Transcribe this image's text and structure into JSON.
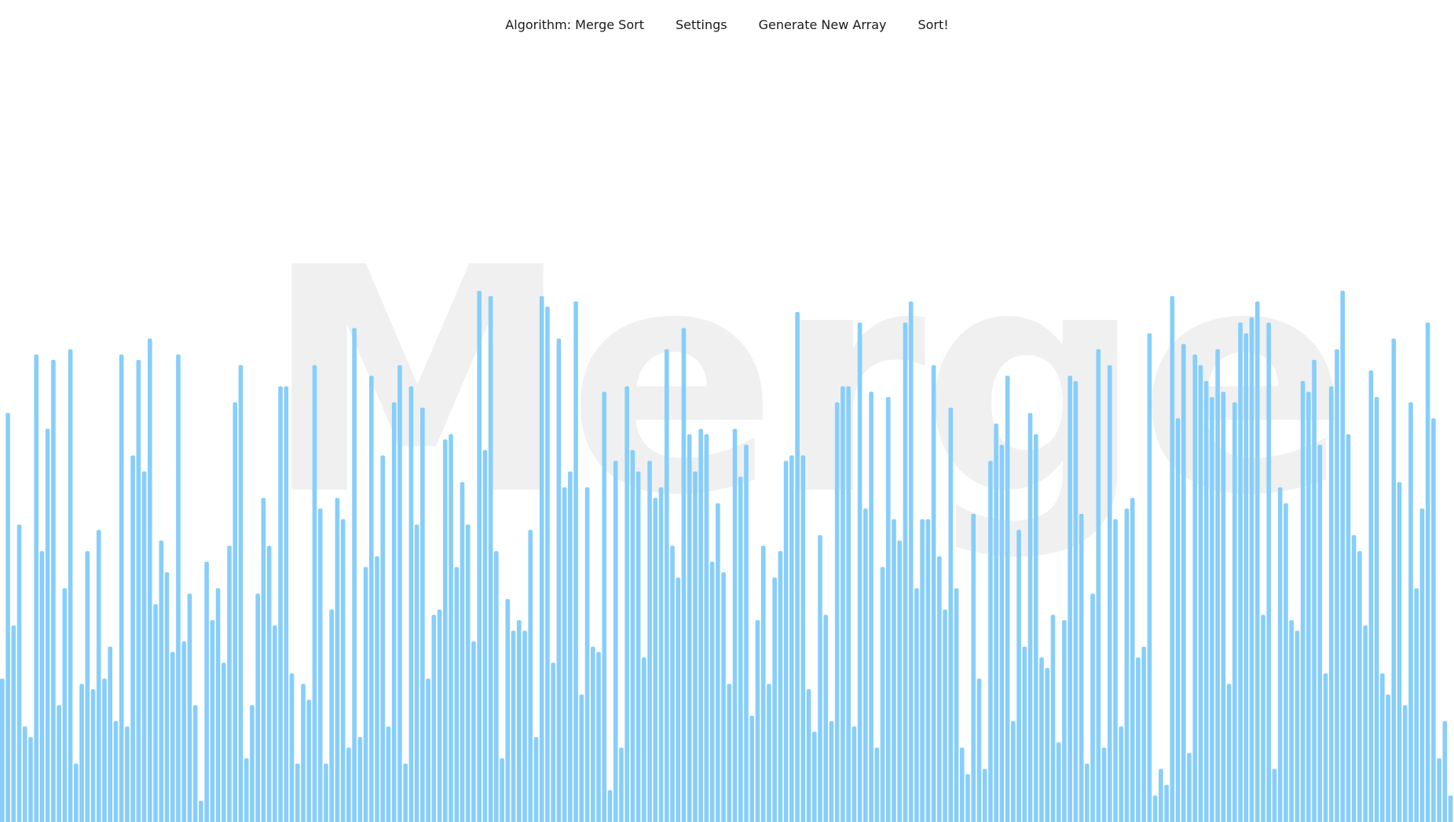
{
  "navbar": {
    "algorithm_label": "Algorithm: Merge Sort",
    "settings_label": "Settings",
    "generate_label": "Generate New Array",
    "sort_label": "Sort!"
  },
  "watermark": {
    "text": "Merge"
  },
  "colors": {
    "bar": "#87cefa",
    "watermark": "#f0f0f0",
    "background": "#ffffff"
  },
  "chart_data": {
    "type": "bar",
    "values": [
      0.27,
      0.77,
      0.37,
      0.56,
      0.18,
      0.16,
      0.88,
      0.51,
      0.74,
      0.87,
      0.22,
      0.44,
      0.89,
      0.11,
      0.26,
      0.51,
      0.25,
      0.55,
      0.27,
      0.33,
      0.19,
      0.88,
      0.18,
      0.69,
      0.87,
      0.66,
      0.91,
      0.41,
      0.53,
      0.47,
      0.32,
      0.88,
      0.34,
      0.43,
      0.22,
      0.04,
      0.49,
      0.38,
      0.44,
      0.3,
      0.52,
      0.79,
      0.86,
      0.12,
      0.22,
      0.43,
      0.61,
      0.52,
      0.37,
      0.82,
      0.82,
      0.28,
      0.11,
      0.26,
      0.23,
      0.86,
      0.59,
      0.11,
      0.4,
      0.61,
      0.57,
      0.14,
      0.93,
      0.16,
      0.48,
      0.84,
      0.5,
      0.69,
      0.18,
      0.79,
      0.86,
      0.11,
      0.82,
      0.56,
      0.78,
      0.27,
      0.39,
      0.4,
      0.72,
      0.73,
      0.48,
      0.64,
      0.56,
      0.34,
      1.0,
      0.7,
      0.99,
      0.51,
      0.12,
      0.42,
      0.36,
      0.38,
      0.36,
      0.55,
      0.16,
      0.99,
      0.97,
      0.3,
      0.91,
      0.63,
      0.66,
      0.98,
      0.24,
      0.63,
      0.33,
      0.32,
      0.81,
      0.06,
      0.68,
      0.14,
      0.82,
      0.7,
      0.66,
      0.31,
      0.68,
      0.61,
      0.63,
      0.89,
      0.52,
      0.46,
      0.93,
      0.73,
      0.66,
      0.74,
      0.73,
      0.49,
      0.6,
      0.47,
      0.26,
      0.74,
      0.65,
      0.71,
      0.2,
      0.38,
      0.52,
      0.26,
      0.46,
      0.51,
      0.68,
      0.69,
      0.96,
      0.69,
      0.25,
      0.17,
      0.54,
      0.39,
      0.19,
      0.79,
      0.82,
      0.82,
      0.18,
      0.94,
      0.59,
      0.81,
      0.14,
      0.48,
      0.8,
      0.57,
      0.53,
      0.94,
      0.98,
      0.44,
      0.57,
      0.57,
      0.86,
      0.5,
      0.4,
      0.78,
      0.44,
      0.14,
      0.09,
      0.58,
      0.27,
      0.1,
      0.68,
      0.75,
      0.71,
      0.84,
      0.19,
      0.55,
      0.33,
      0.77,
      0.73,
      0.31,
      0.29,
      0.39,
      0.15,
      0.38,
      0.84,
      0.83,
      0.58,
      0.11,
      0.43,
      0.89,
      0.14,
      0.86,
      0.57,
      0.18,
      0.59,
      0.61,
      0.31,
      0.33,
      0.92,
      0.05,
      0.1,
      0.07,
      0.99,
      0.76,
      0.9,
      0.13,
      0.88,
      0.86,
      0.83,
      0.8,
      0.89,
      0.81,
      0.26,
      0.79,
      0.94,
      0.92,
      0.95,
      0.98,
      0.39,
      0.94,
      0.1,
      0.63,
      0.6,
      0.38,
      0.36,
      0.83,
      0.81,
      0.87,
      0.71,
      0.28,
      0.82,
      0.89,
      1.0,
      0.73,
      0.54,
      0.51,
      0.37,
      0.85,
      0.8,
      0.28,
      0.24,
      0.91,
      0.64,
      0.22,
      0.79,
      0.44,
      0.59,
      0.94,
      0.76,
      0.12,
      0.19,
      0.05
    ],
    "ylim": [
      0,
      1
    ]
  }
}
